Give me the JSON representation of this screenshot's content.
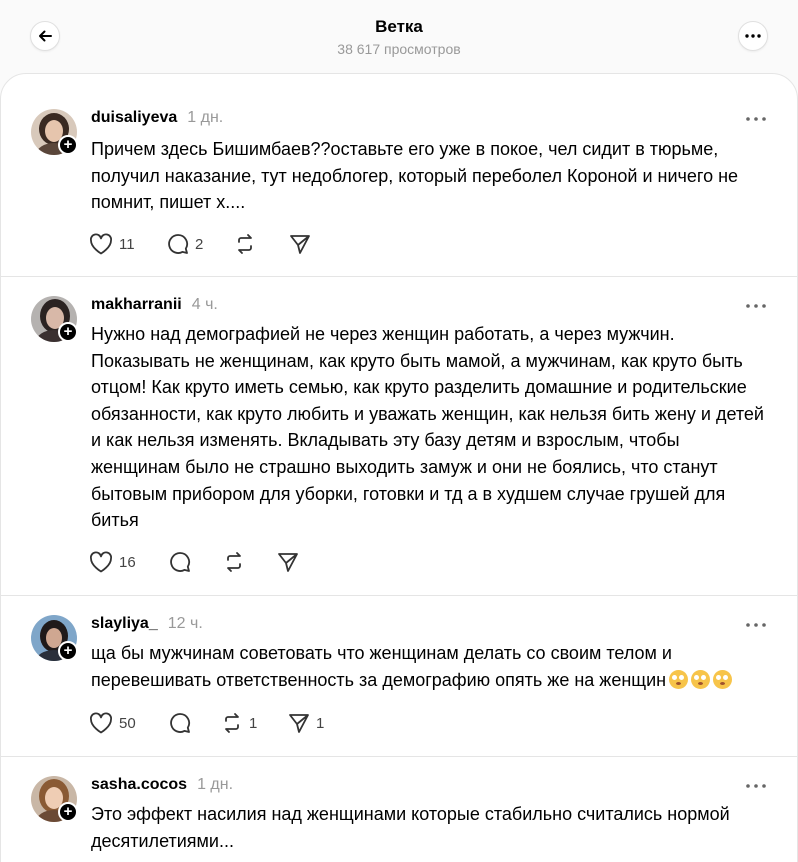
{
  "header": {
    "title": "Ветка",
    "views": "38 617 просмотров"
  },
  "posts": [
    {
      "username": "duisaliyeva",
      "time": "1 дн.",
      "text": "Причем здесь Бишимбаев??оставьте его уже в покое, чел сидит в тюрьме, получил наказание, тут недоблогер, который переболел Короной и ничего не помнит, пишет х....",
      "likes": "11",
      "replies": "2",
      "reposts": "",
      "shares": ""
    },
    {
      "username": "makharranii",
      "time": "4 ч.",
      "text": "Нужно над демографией не через женщин работать, а через мужчин. Показывать не женщинам, как круто быть мамой, а мужчинам, как круто быть отцом! Как круто иметь семью, как круто разделить домашние и родительские обязанности, как круто любить и уважать женщин, как нельзя бить жену и детей и как нельзя изменять. Вкладывать эту базу детям и взрослым, чтобы женщинам было не страшно выходить замуж и они не боялись, что станут бытовым прибором для уборки, готовки и тд а в худшем случае грушей для битья",
      "likes": "16",
      "replies": "",
      "reposts": "",
      "shares": ""
    },
    {
      "username": "slayliya_",
      "time": "12 ч.",
      "text": "ща бы мужчинам советовать что женщинам делать со своим телом и перевешивать ответственность за демографию опять же на женщин",
      "emoji_count": 3,
      "likes": "50",
      "replies": "",
      "reposts": "1",
      "shares": "1"
    },
    {
      "username": "sasha.cocos",
      "time": "1 дн.",
      "text": "Это эффект насилия над женщинами которые стабильно считались нормой десятилетиями..."
    }
  ]
}
